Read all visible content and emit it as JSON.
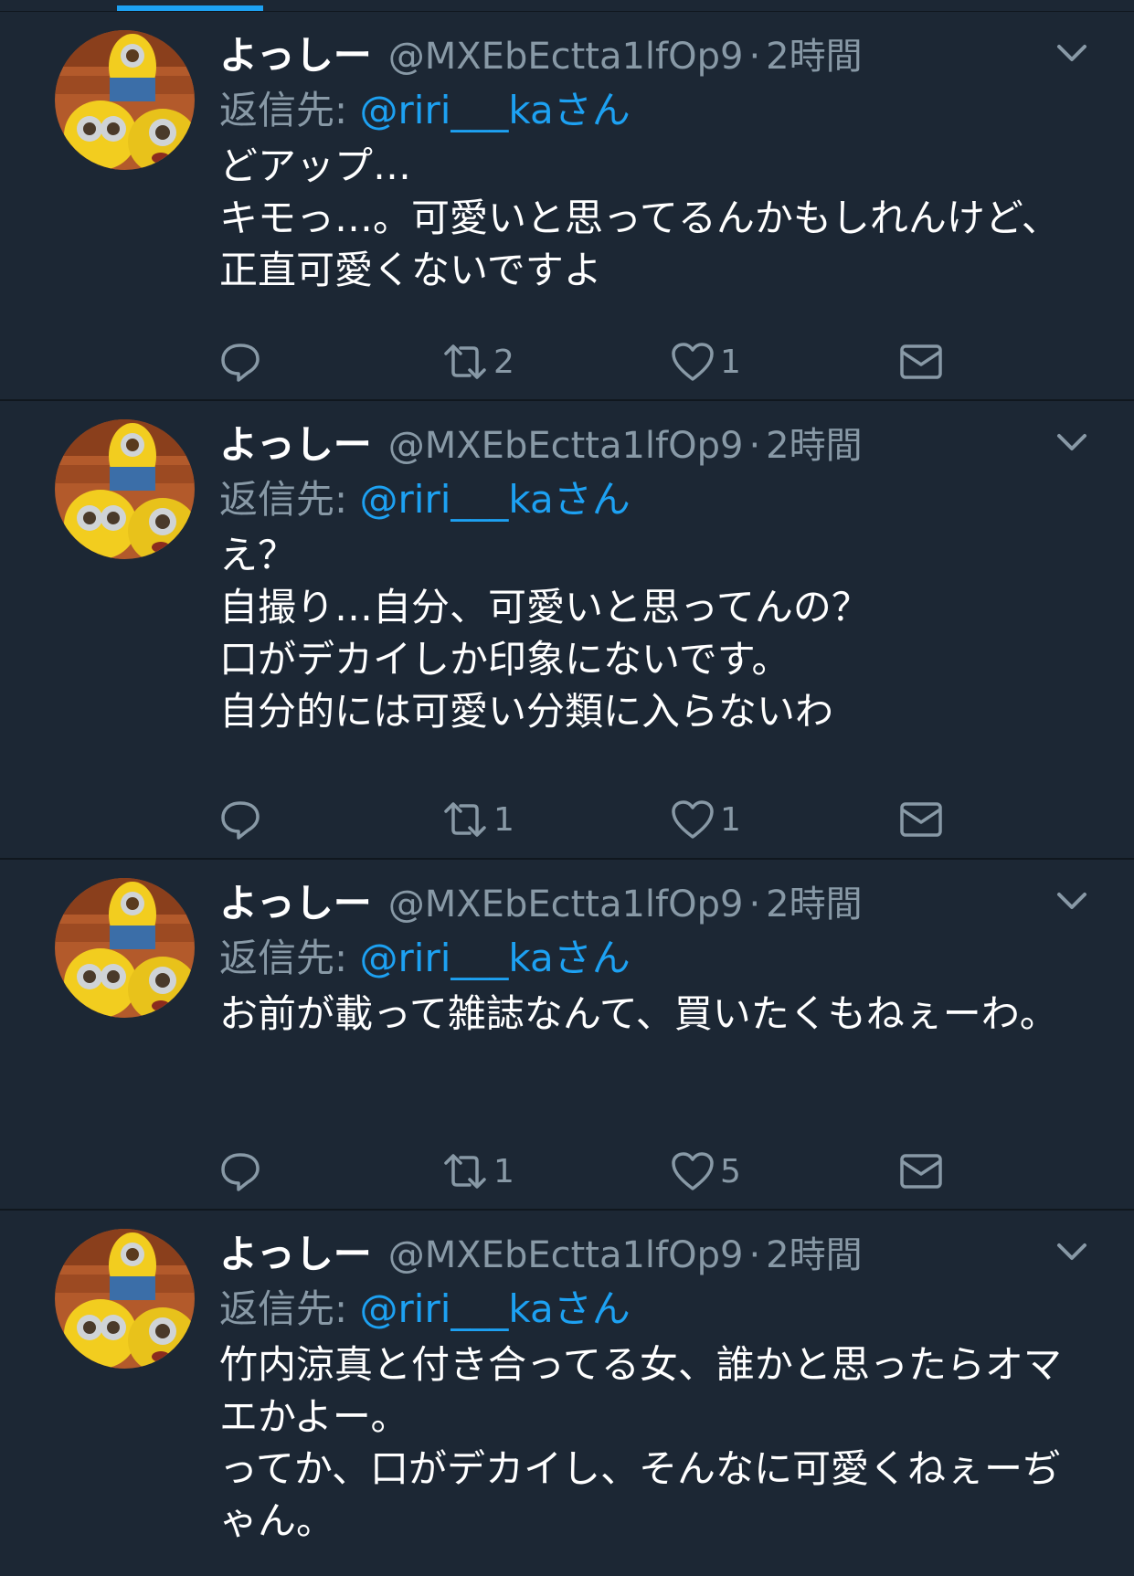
{
  "colors": {
    "background": "#1c2734",
    "accent": "#1da1f2",
    "muted": "#8899a6",
    "divider": "#10171e"
  },
  "tweets": [
    {
      "name": "よっしー",
      "handle": "@MXEbEctta1lfOp9",
      "dot": "·",
      "time": "2時間",
      "reply_prefix": "返信先: ",
      "reply_to": "@riri___kaさん",
      "text": "どアップ…\nキモっ…。可愛いと思ってるんかもしれんけど、正直可愛くないですよ",
      "retweets": "2",
      "likes": "1"
    },
    {
      "name": "よっしー",
      "handle": "@MXEbEctta1lfOp9",
      "dot": "·",
      "time": "2時間",
      "reply_prefix": "返信先: ",
      "reply_to": "@riri___kaさん",
      "text": "え？\n自撮り…自分、可愛いと思ってんの？\n口がデカイしか印象にないです。\n自分的には可愛い分類に入らないわ",
      "retweets": "1",
      "likes": "1"
    },
    {
      "name": "よっしー",
      "handle": "@MXEbEctta1lfOp9",
      "dot": "·",
      "time": "2時間",
      "reply_prefix": "返信先: ",
      "reply_to": "@riri___kaさん",
      "text": "お前が載って雑誌なんて、買いたくもねぇーわ。",
      "retweets": "1",
      "likes": "5"
    },
    {
      "name": "よっしー",
      "handle": "@MXEbEctta1lfOp9",
      "dot": "·",
      "time": "2時間",
      "reply_prefix": "返信先: ",
      "reply_to": "@riri___kaさん",
      "text": "竹内涼真と付き合ってる女、誰かと思ったらオマエかよー。\nってか、口がデカイし、そんなに可愛くねぇーぢゃん。",
      "retweets": "",
      "likes": ""
    }
  ],
  "icons": {
    "reply": "reply-icon",
    "retweet": "retweet-icon",
    "like": "heart-icon",
    "dm": "envelope-icon",
    "more": "chevron-down-icon",
    "avatar": "minion-avatar"
  }
}
